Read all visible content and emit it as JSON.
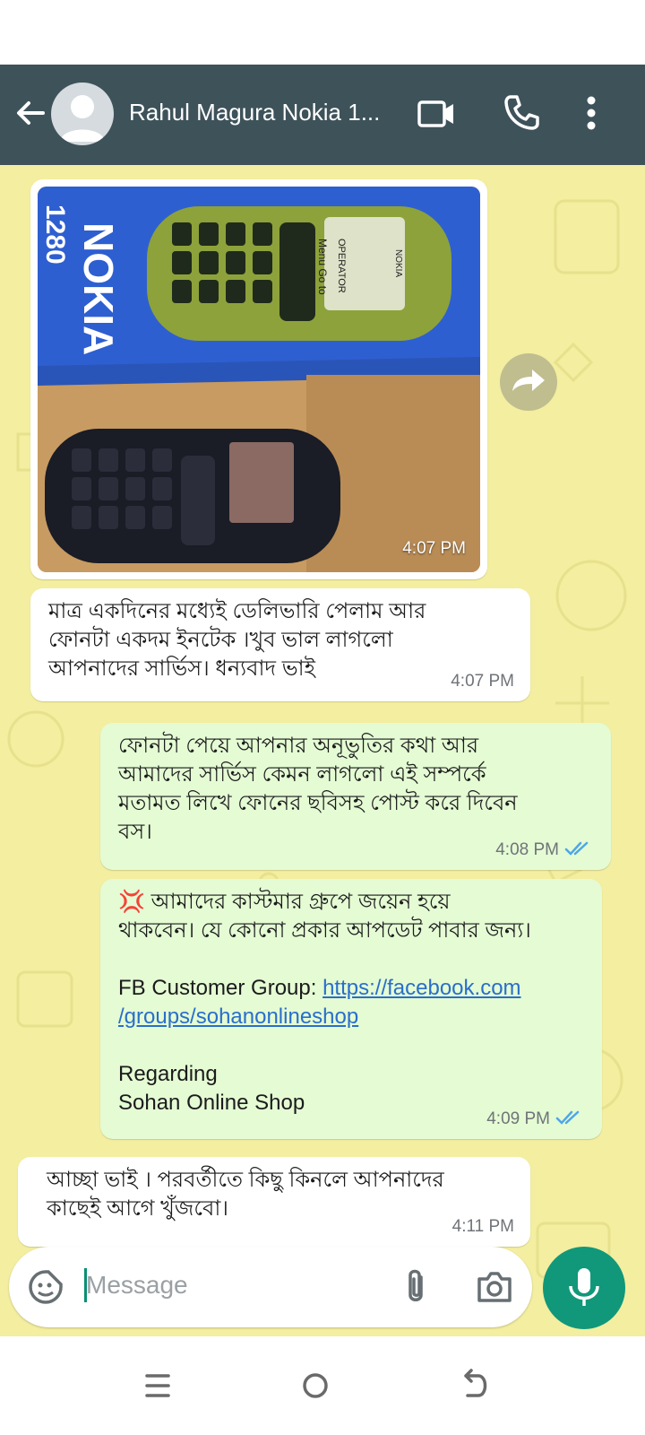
{
  "header": {
    "contact_name": "Rahul Magura Nokia 1...",
    "icons": [
      "back-arrow-icon",
      "avatar-placeholder",
      "video-call-icon",
      "phone-icon",
      "more-options-icon"
    ],
    "background_color": "#3e525a"
  },
  "messages": [
    {
      "direction": "incoming",
      "type": "image",
      "image_text": {
        "brand": "NOKIA",
        "model_partial": "1280",
        "screen_top": "OPERATOR",
        "screen_left": "Menu",
        "screen_right": "Go to"
      },
      "time": "4:07 PM"
    },
    {
      "direction": "incoming",
      "type": "text",
      "text": "মাত্র একদিনের মধ্যেই ডেলিভারি পেলাম আর\nফোনটা একদম ইনটেক ।খুব ভাল লাগলো\nআপনাদের সার্ভিস। ধন্যবাদ ভাই",
      "time": "4:07 PM"
    },
    {
      "direction": "outgoing",
      "type": "text",
      "text": "ফোনটা পেয়ে আপনার অনূভুতির কথা আর\nআমাদের সার্ভিস কেমন লাগলো এই সম্পর্কে\nমতামত লিখে ফোনের ছবিসহ পোস্ট করে দিবেন\nবস।",
      "time": "4:08 PM",
      "status": "read"
    },
    {
      "direction": "outgoing",
      "type": "text",
      "emoji": "💢",
      "line1": "আমাদের কাস্টমার গ্রুপে জয়েন হয়ে",
      "line2": "থাকবেন। যে কোনো প্রকার আপডেট পাবার জন্য।",
      "group_label": "FB Customer Group: ",
      "link_part1": "https://facebook.com",
      "link_part2": "/groups/sohanonlineshop",
      "sign_line1": "Regarding",
      "sign_line2": "Sohan Online Shop",
      "time": "4:09 PM",
      "status": "read"
    },
    {
      "direction": "incoming",
      "type": "text",
      "text": "আচ্ছা ভাই । পরবর্তীতে কিছু কিনলে আপনাদের\nকাছেই আগে খুঁজবো।",
      "time": "4:11 PM"
    }
  ],
  "composer": {
    "placeholder": "Message",
    "icons": [
      "sticker-icon",
      "attach-icon",
      "camera-icon",
      "mic-icon"
    ]
  },
  "nav": {
    "icons": [
      "recent-apps-icon",
      "home-icon",
      "back-icon"
    ]
  },
  "colors": {
    "wallpaper": "#f3eea0",
    "incoming_bubble": "#ffffff",
    "outgoing_bubble": "#e4fbd4",
    "accent": "#11987a",
    "read_ticks": "#4fa6e6",
    "link": "#2a6ecb"
  }
}
